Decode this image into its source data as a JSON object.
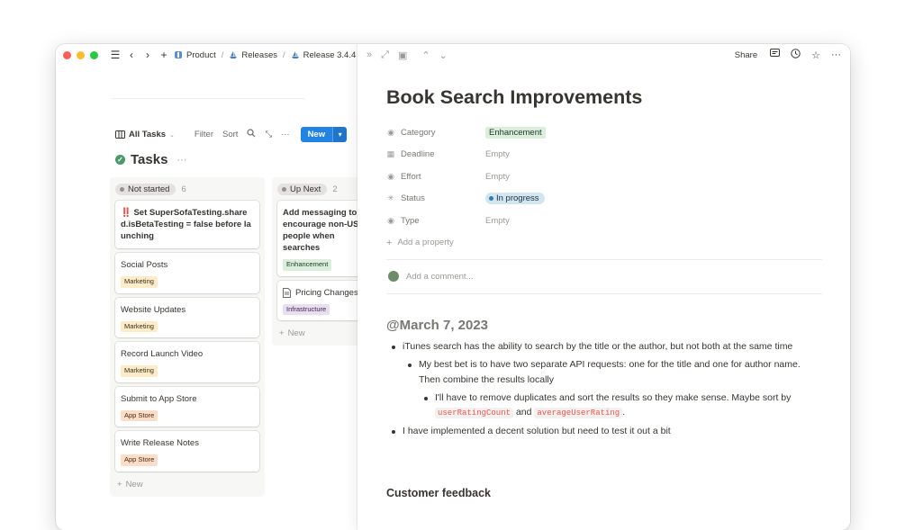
{
  "breadcrumb": {
    "items": [
      {
        "label": "Product"
      },
      {
        "label": "Releases"
      },
      {
        "label": "Release 3.4.4"
      }
    ],
    "separator": "/"
  },
  "toolbar": {
    "view_label": "All Tasks",
    "filter_label": "Filter",
    "sort_label": "Sort",
    "new_label": "New"
  },
  "board": {
    "title": "Tasks",
    "columns": [
      {
        "status": "Not started",
        "count": "6",
        "cards": [
          {
            "prefix": "‼️ ",
            "title": "Set SuperSofaTesting.shared.isBetaTesting = false before launching"
          },
          {
            "title": "Social Posts",
            "tag": "Marketing"
          },
          {
            "title": "Website Updates",
            "tag": "Marketing"
          },
          {
            "title": "Record Launch Video",
            "tag": "Marketing"
          },
          {
            "title": "Submit to App Store",
            "tag": "App Store"
          },
          {
            "title": "Write Release Notes",
            "tag": "App Store"
          }
        ],
        "new_label": "New"
      },
      {
        "status": "Up Next",
        "count": "2",
        "cards": [
          {
            "title": "Add messaging to encourage non-US people when searches",
            "tag": "Enhancement"
          },
          {
            "title": "Pricing Changes",
            "tag": "Infrastructure"
          }
        ],
        "new_label": "New"
      }
    ]
  },
  "page": {
    "top_share": "Share",
    "title": "Book Search Improvements",
    "properties": [
      {
        "name": "Category",
        "value": "Enhancement",
        "kind": "tag"
      },
      {
        "name": "Deadline",
        "value": "Empty",
        "kind": "empty"
      },
      {
        "name": "Effort",
        "value": "Empty",
        "kind": "empty"
      },
      {
        "name": "Status",
        "value": "In progress",
        "kind": "status"
      },
      {
        "name": "Type",
        "value": "Empty",
        "kind": "empty"
      }
    ],
    "add_property": "Add a property",
    "comment_placeholder": "Add a comment...",
    "date_heading": "@March 7, 2023",
    "bullets": {
      "b1": "iTunes search has the ability to search by the title or the author, but not both at the same time",
      "b2": "My best bet is to have two separate API requests: one for the title and one for author name. Then combine the results locally",
      "b3_pre": "I'll have to remove duplicates and sort the results so they make sense. Maybe sort by",
      "b3_code1": "userRatingCount",
      "b3_and": "and",
      "b3_code2": "averageUserRating",
      "b3_end": ".",
      "b4": "I have implemented a decent solution but need to test it out a bit"
    },
    "section_heading": "Customer feedback"
  },
  "colors": {
    "accent": "#2383e2",
    "tag_marketing": "#fdecc8",
    "tag_appstore": "#fadec9",
    "tag_enhancement": "#dbeddb",
    "tag_infrastructure": "#e8deee",
    "status_in_progress": "#d3e5ef"
  }
}
